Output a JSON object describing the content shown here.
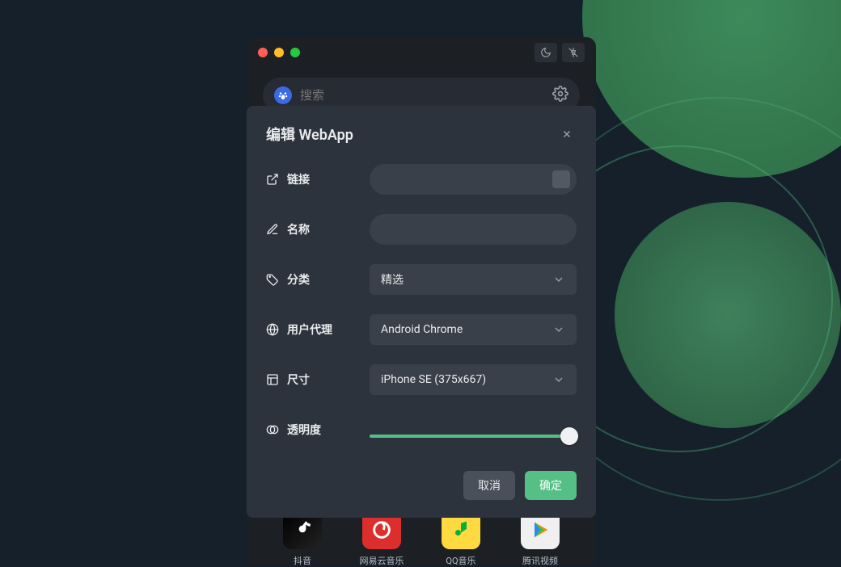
{
  "search": {
    "placeholder": "搜索"
  },
  "apps": [
    {
      "label": "抖音"
    },
    {
      "label": "网易云音乐"
    },
    {
      "label": "QQ音乐"
    },
    {
      "label": "腾讯视频"
    }
  ],
  "dialog": {
    "title": "编辑 WebApp",
    "fields": {
      "link": {
        "label": "链接",
        "value": ""
      },
      "name": {
        "label": "名称",
        "value": ""
      },
      "category": {
        "label": "分类",
        "value": "精选"
      },
      "user_agent": {
        "label": "用户代理",
        "value": "Android Chrome"
      },
      "size": {
        "label": "尺寸",
        "value": "iPhone SE (375x667)"
      },
      "opacity": {
        "label": "透明度",
        "value": 100
      }
    },
    "buttons": {
      "cancel": "取消",
      "confirm": "确定"
    }
  }
}
